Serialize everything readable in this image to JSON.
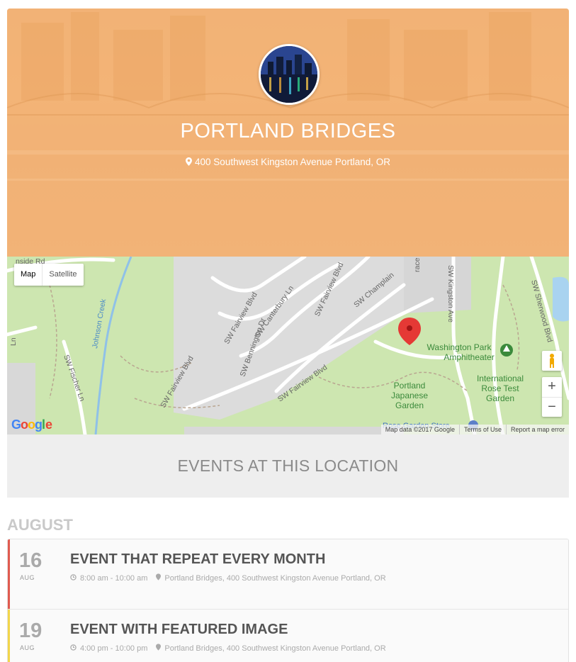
{
  "location": {
    "title": "PORTLAND BRIDGES",
    "address": "400 Southwest Kingston Avenue Portland, OR"
  },
  "map": {
    "type_map": "Map",
    "type_satellite": "Satellite",
    "zoom_in": "+",
    "zoom_out": "−",
    "google": "Google",
    "attribution": [
      "Map data ©2017 Google",
      "Terms of Use",
      "Report a map error"
    ],
    "labels": {
      "road1": "SW Fairview Blvd",
      "road2": "SW Canterbury Ln",
      "road3": "SW Bennington Dr",
      "road4": "SW Fairview Blvd",
      "road5": "SW Champlain",
      "road6": "SW Kingston Ave",
      "road7": "SW Sherwood Blvd",
      "road8": "SW Fischer Ln",
      "road9": "SW Fairview Blvd",
      "road10": "SW Fairview Blvd",
      "creek": "Johnson Creek",
      "rd_top": "nside Rd",
      "ln_left": "Ln",
      "race": "race",
      "park1": "Washington Park",
      "park2": "Amphitheater",
      "garden1": "Portland",
      "garden2": "Japanese",
      "garden3": "Garden",
      "rose1": "International",
      "rose2": "Rose Test",
      "rose3": "Garden",
      "store": "Rose Garden Store"
    }
  },
  "events_header": "EVENTS AT THIS LOCATION",
  "month": "AUGUST",
  "events": [
    {
      "day": "16",
      "month": "AUG",
      "title": "EVENT THAT REPEAT EVERY MONTH",
      "time": "8:00 am - 10:00 am",
      "venue": "Portland Bridges, 400 Southwest Kingston Avenue Portland, OR",
      "color": "#e05a4f"
    },
    {
      "day": "19",
      "month": "AUG",
      "title": "EVENT WITH FEATURED IMAGE",
      "time": "4:00 pm - 10:00 pm",
      "venue": "Portland Bridges, 400 Southwest Kingston Avenue Portland, OR",
      "color": "#f2d64b"
    }
  ],
  "colors": {
    "hero_tint": "#f2b47a",
    "map_green": "#cde6b0",
    "map_road": "#ffffff",
    "map_block": "#d9d9d9",
    "marker_red": "#e53935"
  }
}
